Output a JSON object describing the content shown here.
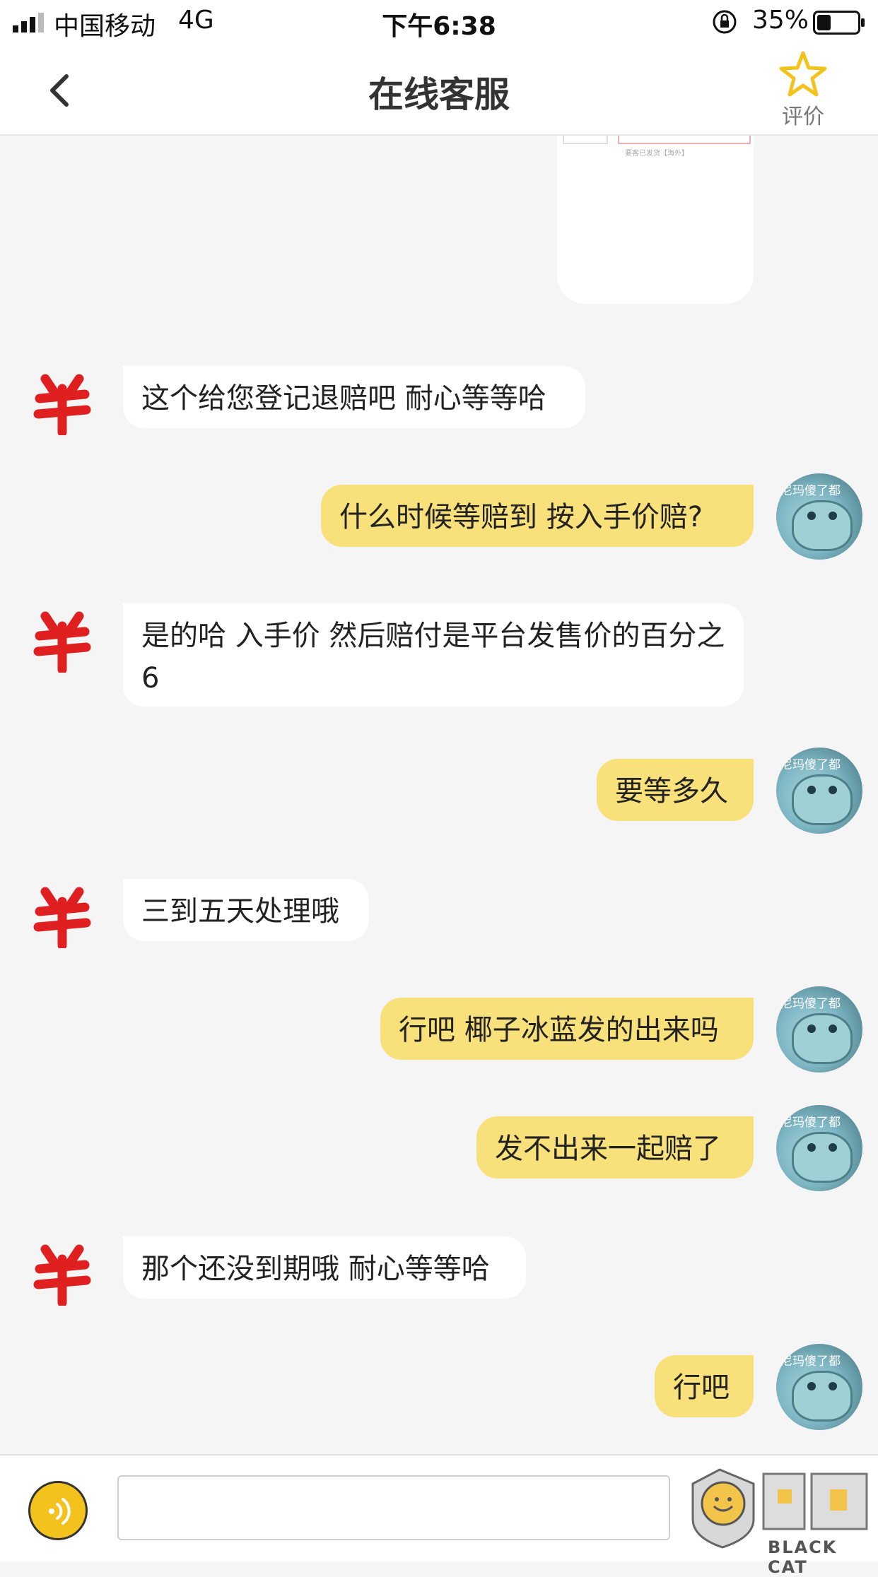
{
  "status_bar": {
    "carrier": "中国移动",
    "network": "4G",
    "time": "下午6:38",
    "battery_percent": "35%",
    "battery_level": 0.35
  },
  "header": {
    "title": "在线客服",
    "rate_label": "评价"
  },
  "image_preview": {
    "caption": "要客已发货【海外】"
  },
  "messages": [
    {
      "sender": "agent",
      "text": "这个给您登记退赔吧 耐心等等哈"
    },
    {
      "sender": "user",
      "text": "什么时候等赔到 按入手价赔?"
    },
    {
      "sender": "agent",
      "text": "是的哈 入手价 然后赔付是平台发售价的百分之6"
    },
    {
      "sender": "user",
      "text": "要等多久"
    },
    {
      "sender": "agent",
      "text": "三到五天处理哦"
    },
    {
      "sender": "user",
      "text": "行吧 椰子冰蓝发的出来吗"
    },
    {
      "sender": "user",
      "text": "发不出来一起赔了"
    },
    {
      "sender": "agent",
      "text": "那个还没到期哦 耐心等等哈"
    },
    {
      "sender": "user",
      "text": "行吧"
    }
  ],
  "user_avatar_caption": "尼玛傻了都",
  "input": {
    "value": "",
    "placeholder": ""
  },
  "watermark": {
    "brand_en": "BLACK CAT"
  },
  "colors": {
    "user_bubble": "#f8e07a",
    "agent_bubble": "#ffffff",
    "agent_logo": "#e02020",
    "voice_button": "#f4c21d",
    "star": "#f4c21d"
  },
  "icons": {
    "back": "chevron-left-icon",
    "rate": "star-icon",
    "voice": "voice-icon",
    "agent_avatar": "brand-logo-icon"
  }
}
